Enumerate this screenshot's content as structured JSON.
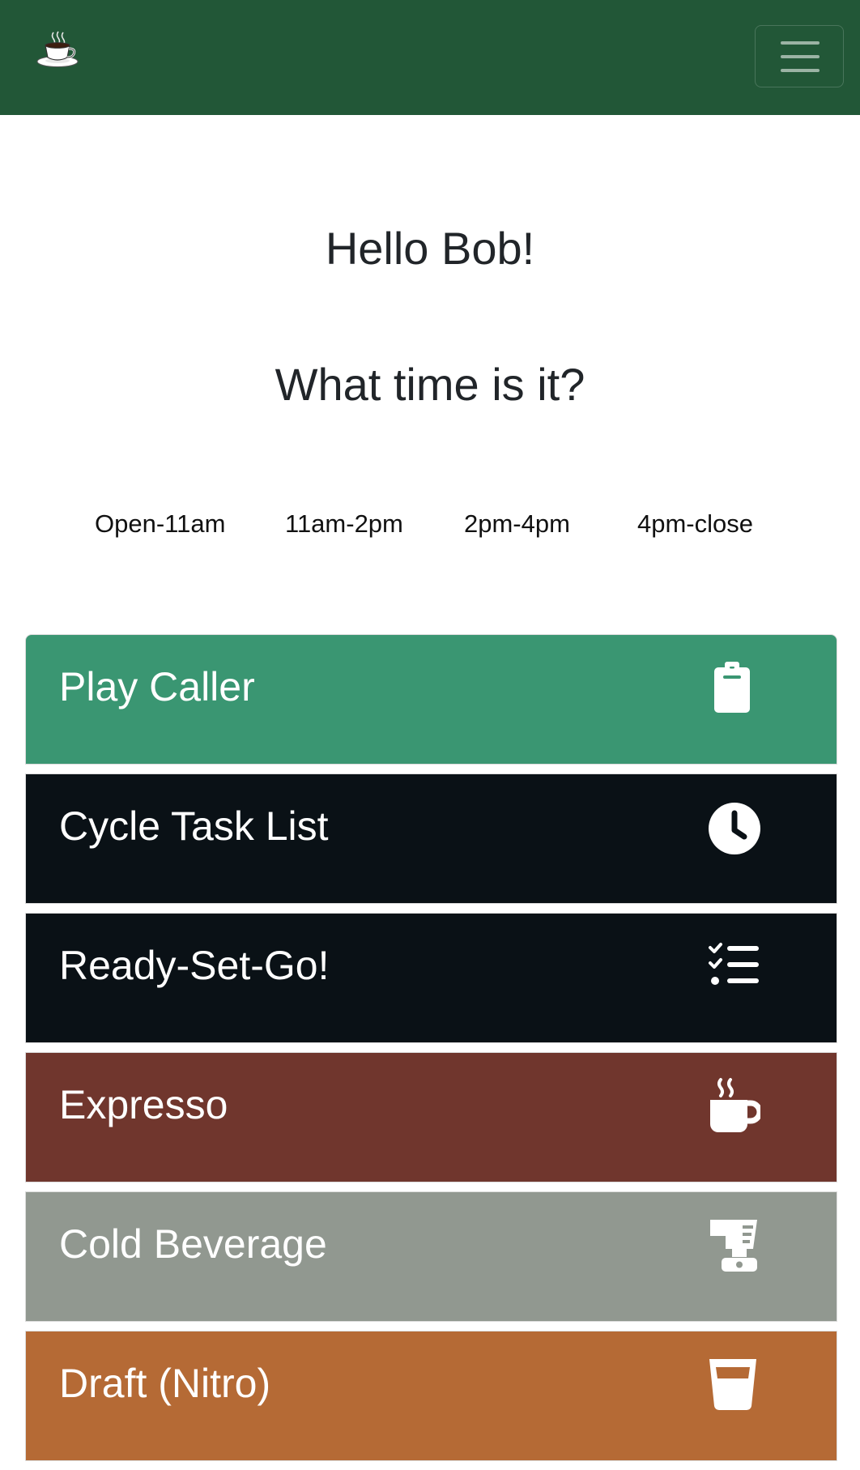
{
  "navbar": {
    "brand_icon": "coffee-cup-icon",
    "toggler_icon": "hamburger-menu-icon",
    "background": "#225737"
  },
  "greeting": "Hello Bob!",
  "question": "What time is it?",
  "time_slots": [
    "Open-11am",
    "11am-2pm",
    "2pm-4pm",
    "4pm-close"
  ],
  "cards": [
    {
      "label": "Play Caller",
      "icon": "clipboard-icon",
      "color": "#3a9672"
    },
    {
      "label": "Cycle Task List",
      "icon": "clock-icon",
      "color": "#0a1116"
    },
    {
      "label": "Ready-Set-Go!",
      "icon": "checklist-icon",
      "color": "#0a1116"
    },
    {
      "label": "Expresso",
      "icon": "hot-mug-icon",
      "color": "#70362d"
    },
    {
      "label": "Cold Beverage",
      "icon": "blender-icon",
      "color": "#919890"
    },
    {
      "label": "Draft (Nitro)",
      "icon": "glass-icon",
      "color": "#b56a35"
    }
  ]
}
